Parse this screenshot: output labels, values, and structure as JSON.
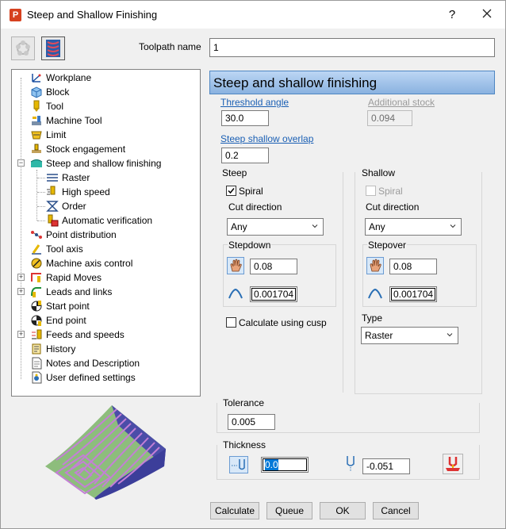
{
  "window": {
    "title": "Steep and Shallow Finishing",
    "help": "?",
    "close": "✕"
  },
  "toolpath": {
    "label": "Toolpath name",
    "value": "1"
  },
  "tree": {
    "items": [
      {
        "label": "Workplane"
      },
      {
        "label": "Block"
      },
      {
        "label": "Tool"
      },
      {
        "label": "Machine Tool"
      },
      {
        "label": "Limit"
      },
      {
        "label": "Stock engagement"
      },
      {
        "label": "Steep and shallow finishing"
      },
      {
        "label": "Raster"
      },
      {
        "label": "High speed"
      },
      {
        "label": "Order"
      },
      {
        "label": "Automatic verification"
      },
      {
        "label": "Point distribution"
      },
      {
        "label": "Tool axis"
      },
      {
        "label": "Machine axis control"
      },
      {
        "label": "Rapid Moves"
      },
      {
        "label": "Leads and links"
      },
      {
        "label": "Start point"
      },
      {
        "label": "End point"
      },
      {
        "label": "Feeds and speeds"
      },
      {
        "label": "History"
      },
      {
        "label": "Notes and Description"
      },
      {
        "label": "User defined settings"
      }
    ]
  },
  "page": {
    "title": "Steep and shallow finishing",
    "threshold_angle_label": "Threshold angle",
    "threshold_angle": "30.0",
    "additional_stock_label": "Additional stock",
    "additional_stock": "0.094",
    "overlap_label": "Steep shallow overlap",
    "overlap": "0.2"
  },
  "steep": {
    "title": "Steep",
    "spiral_label": "Spiral",
    "cut_direction_label": "Cut direction",
    "cut_direction": "Any",
    "stepdown_title": "Stepdown",
    "stepdown": "0.08",
    "stepdown_cusp": "0.001704",
    "cusp_label": "Calculate using cusp"
  },
  "shallow": {
    "title": "Shallow",
    "spiral_label": "Spiral",
    "cut_direction_label": "Cut direction",
    "cut_direction": "Any",
    "stepover_title": "Stepover",
    "stepover": "0.08",
    "stepover_cusp": "0.001704",
    "type_label": "Type",
    "type": "Raster"
  },
  "tolerance": {
    "title": "Tolerance",
    "value": "0.005"
  },
  "thickness": {
    "title": "Thickness",
    "radial": "0.0",
    "axial": "-0.051"
  },
  "buttons": {
    "calculate": "Calculate",
    "queue": "Queue",
    "ok": "OK",
    "cancel": "Cancel"
  }
}
